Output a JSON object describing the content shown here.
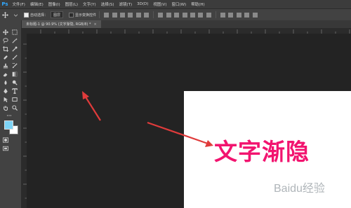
{
  "app": {
    "logo": "Ps"
  },
  "menu": [
    "文件(F)",
    "编辑(E)",
    "图像(I)",
    "图层(L)",
    "文字(Y)",
    "选择(S)",
    "滤镜(T)",
    "3D(D)",
    "视图(V)",
    "窗口(W)",
    "帮助(H)"
  ],
  "options": {
    "auto_select_label": "自动选择：",
    "auto_select_value": "图层",
    "transform_label": "显示变换控件"
  },
  "document_tab": {
    "label": "未标题-1 @ 90.9% (文字渐隐, RGB/8) *",
    "close": "×"
  },
  "canvas_text": "文字渐隐",
  "watermark": "Baidu经验",
  "colors": {
    "accent_text": "#f2146f",
    "annotation_arrow": "#e03b3b",
    "foreground": "#7dd3f5",
    "background": "#ffffff"
  }
}
